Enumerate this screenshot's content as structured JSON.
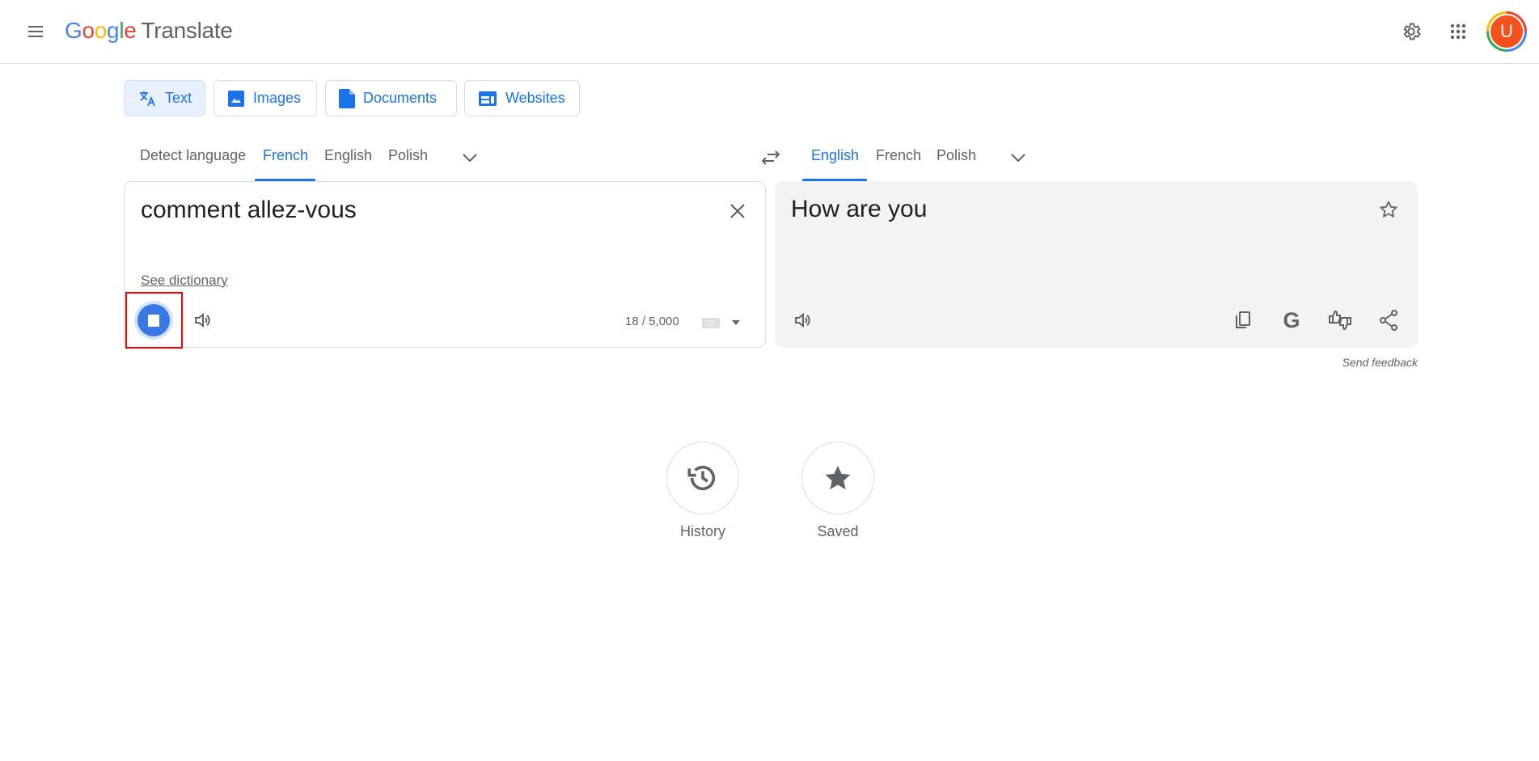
{
  "header": {
    "logo_google": [
      "G",
      "o",
      "o",
      "g",
      "l",
      "e"
    ],
    "logo_product": "Translate",
    "avatar_initial": "U"
  },
  "modes": [
    {
      "label": "Text",
      "icon": "translate-icon",
      "active": true
    },
    {
      "label": "Images",
      "icon": "image-icon"
    },
    {
      "label": "Documents",
      "icon": "document-icon"
    },
    {
      "label": "Websites",
      "icon": "website-icon"
    }
  ],
  "source_langs": [
    "Detect language",
    "French",
    "English",
    "Polish"
  ],
  "source_selected": "French",
  "target_langs": [
    "English",
    "French",
    "Polish"
  ],
  "target_selected": "English",
  "source": {
    "text": "comment allez-vous",
    "dictionary_link": "See dictionary",
    "char_count": "18 / 5,000"
  },
  "target": {
    "text": "How are you"
  },
  "send_feedback": "Send feedback",
  "bottom": {
    "history": "History",
    "saved": "Saved"
  },
  "colors": {
    "accent": "#1a73e8",
    "mic_active": "#3b78e7",
    "avatar": "#f4511e",
    "highlight": "#ff0000"
  }
}
